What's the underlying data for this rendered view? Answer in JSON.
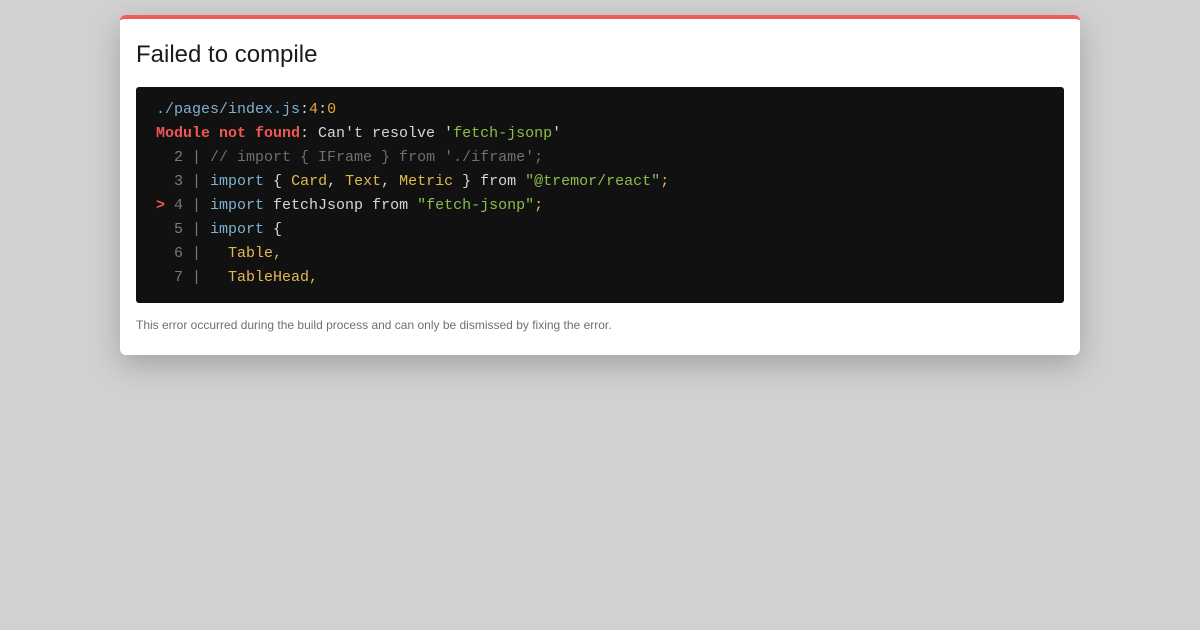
{
  "dialog": {
    "title": "Failed to compile",
    "footer": "This error occurred during the build process and can only be dismissed by fixing the error."
  },
  "error": {
    "file_path": "./pages/index.js",
    "line": "4",
    "column": "0",
    "sep1": ":",
    "sep2": ":",
    "type": "Module not found",
    "message_prefix": ": Can't resolve '",
    "module": "fetch-jsonp",
    "message_suffix": "'"
  },
  "code": {
    "lines": [
      {
        "marker": " ",
        "gutter": " 2 | ",
        "tokens": [
          {
            "cls": "c-comment",
            "text": "// import { IFrame } from './iframe';"
          }
        ]
      },
      {
        "marker": " ",
        "gutter": " 3 | ",
        "tokens": [
          {
            "cls": "c-kw",
            "text": "import"
          },
          {
            "cls": "c-text",
            "text": " { "
          },
          {
            "cls": "c-id",
            "text": "Card"
          },
          {
            "cls": "c-text",
            "text": ", "
          },
          {
            "cls": "c-id",
            "text": "Text"
          },
          {
            "cls": "c-text",
            "text": ", "
          },
          {
            "cls": "c-id",
            "text": "Metric"
          },
          {
            "cls": "c-text",
            "text": " } from "
          },
          {
            "cls": "c-str",
            "text": "\"@tremor/react\""
          },
          {
            "cls": "c-id",
            "text": ";"
          }
        ]
      },
      {
        "marker": ">",
        "gutter": " 4 | ",
        "tokens": [
          {
            "cls": "c-kw",
            "text": "import"
          },
          {
            "cls": "c-text",
            "text": " fetchJsonp from "
          },
          {
            "cls": "c-str",
            "text": "\"fetch-jsonp\""
          },
          {
            "cls": "c-id",
            "text": ";"
          }
        ]
      },
      {
        "marker": " ",
        "gutter": " 5 | ",
        "tokens": [
          {
            "cls": "c-kw",
            "text": "import"
          },
          {
            "cls": "c-text",
            "text": " {"
          }
        ]
      },
      {
        "marker": " ",
        "gutter": " 6 | ",
        "tokens": [
          {
            "cls": "c-text",
            "text": "  "
          },
          {
            "cls": "c-id",
            "text": "Table,"
          }
        ]
      },
      {
        "marker": " ",
        "gutter": " 7 | ",
        "tokens": [
          {
            "cls": "c-text",
            "text": "  "
          },
          {
            "cls": "c-id",
            "text": "TableHead,"
          }
        ]
      }
    ]
  },
  "colors": {
    "accent_bar": "#ea5e5e",
    "error_red": "#f25757",
    "code_background": "#111111",
    "overlay_background": "#d1d1d1"
  }
}
